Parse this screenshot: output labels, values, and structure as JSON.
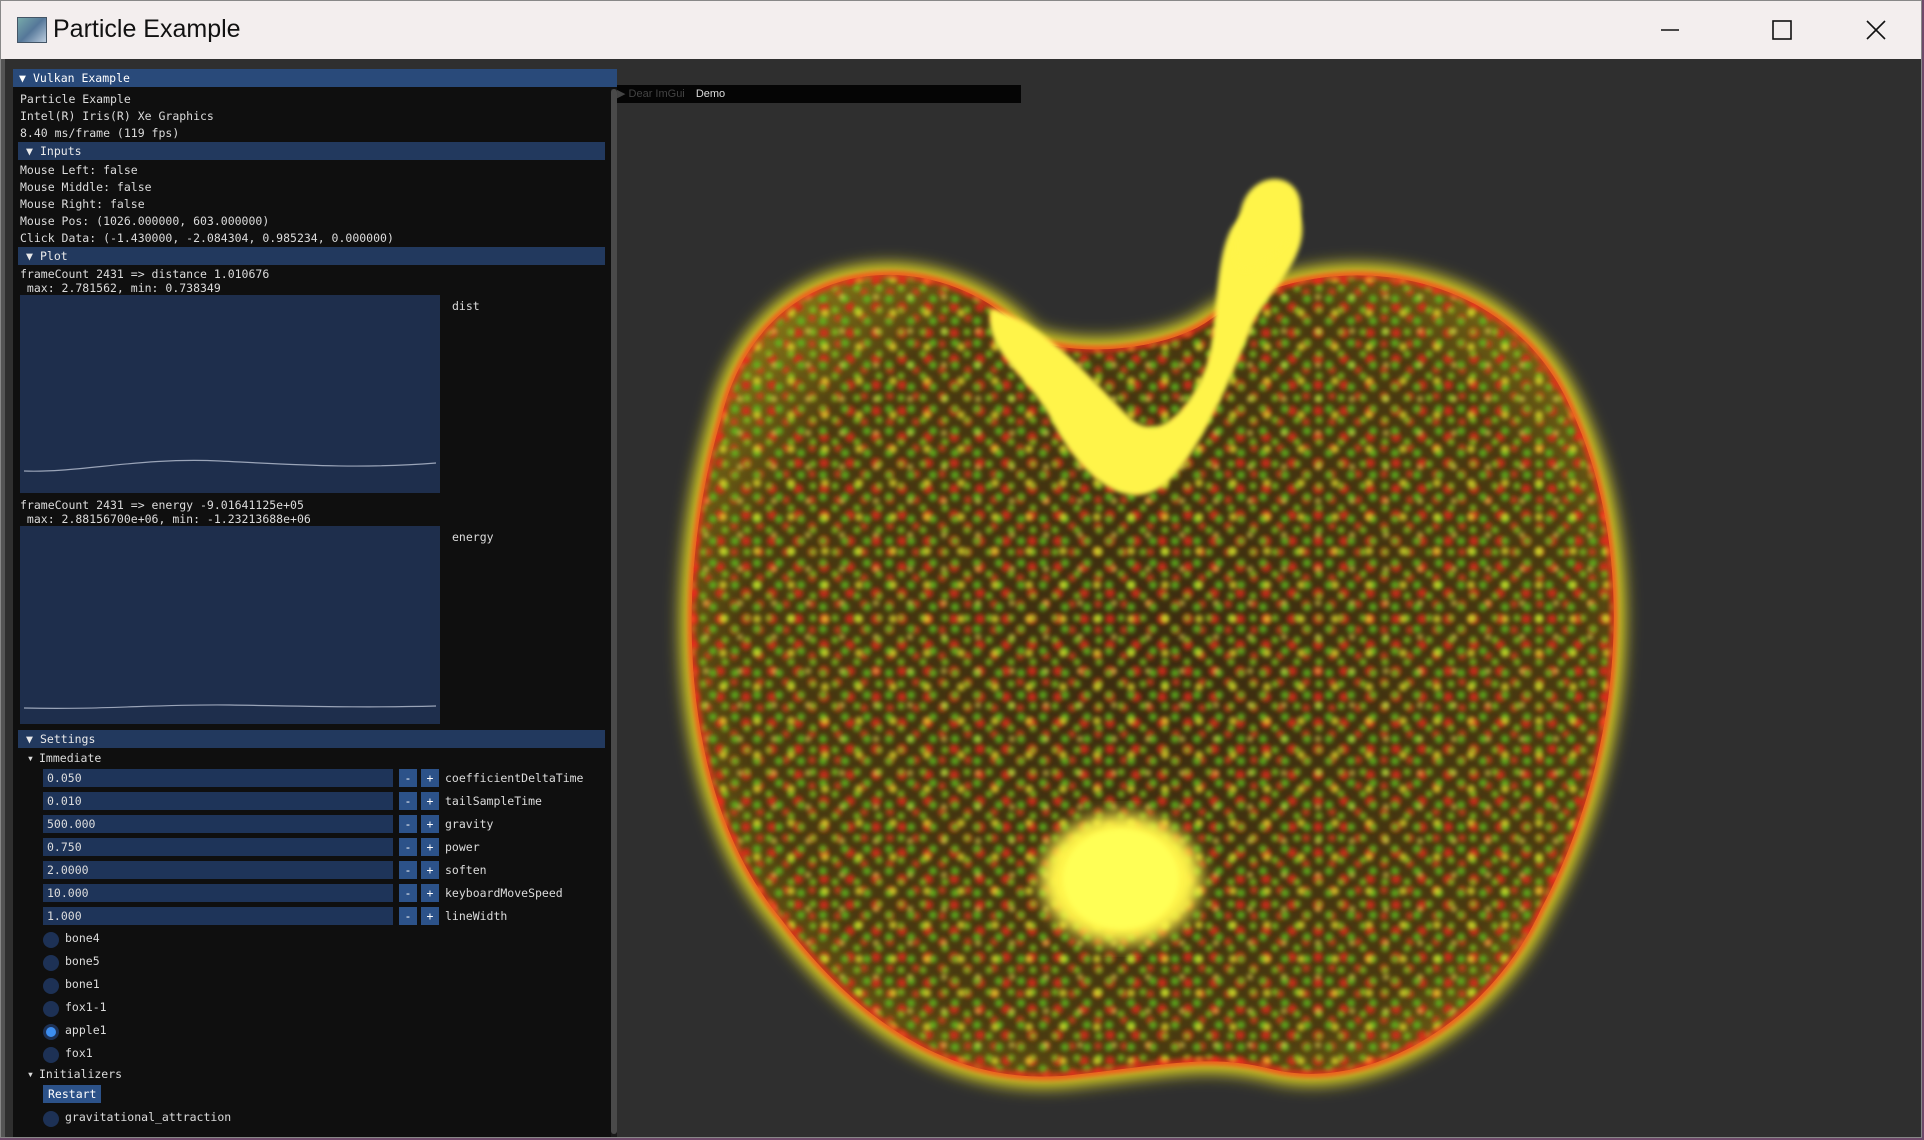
{
  "window": {
    "title": "Particle Example",
    "controls": {
      "minimize": "minimize-icon",
      "maximize": "maximize-icon",
      "close": "close-icon"
    }
  },
  "panel": {
    "title": "Vulkan Example",
    "info": [
      "Particle Example",
      "Intel(R) Iris(R) Xe Graphics",
      "8.40 ms/frame (119 fps)"
    ],
    "inputs": {
      "header": "Inputs",
      "lines": [
        "Mouse Left: false",
        "Mouse Middle: false",
        "Mouse Right: false",
        "Mouse Pos: (1026.000000, 603.000000)",
        "Click Data: (-1.430000, -2.084304, 0.985234, 0.000000)"
      ]
    },
    "plot": {
      "header": "Plot",
      "dist": {
        "line1": "frameCount 2431 => distance 1.010676",
        "line2": " max: 2.781562, min: 0.738349",
        "label": "dist"
      },
      "energy": {
        "line1": "frameCount 2431 => energy -9.01641125e+05",
        "line2": " max: 2.88156700e+06, min: -1.23213688e+06",
        "label": "energy"
      }
    },
    "settings": {
      "header": "Settings",
      "immediate": {
        "label": "Immediate",
        "fields": [
          {
            "value": "0.050",
            "name": "coefficientDeltaTime"
          },
          {
            "value": "0.010",
            "name": "tailSampleTime"
          },
          {
            "value": "500.000",
            "name": "gravity"
          },
          {
            "value": "0.750",
            "name": "power"
          },
          {
            "value": "2.0000",
            "name": "soften"
          },
          {
            "value": "10.000",
            "name": "keyboardMoveSpeed"
          },
          {
            "value": "1.000",
            "name": "lineWidth"
          }
        ],
        "minus": "-",
        "plus": "+"
      },
      "models": [
        {
          "label": "bone4",
          "selected": false
        },
        {
          "label": "bone5",
          "selected": false
        },
        {
          "label": "bone1",
          "selected": false
        },
        {
          "label": "fox1-1",
          "selected": false
        },
        {
          "label": "apple1",
          "selected": true
        },
        {
          "label": "fox1",
          "selected": false
        }
      ],
      "initializers": {
        "label": "Initializers",
        "restart": "Restart",
        "first_option": "gravitational_attraction"
      }
    }
  },
  "demo_window": {
    "faded": "▶ Dear ImGui",
    "label": "Demo"
  },
  "colors": {
    "panel_bg": "#0f0f0f",
    "header": "#22395e",
    "accent": "#3d8ef0",
    "viewport": "#2f2f2f",
    "particle_yellow": "#ffff33",
    "particle_red": "#ff2a1a",
    "particle_green": "#6cd11c"
  }
}
